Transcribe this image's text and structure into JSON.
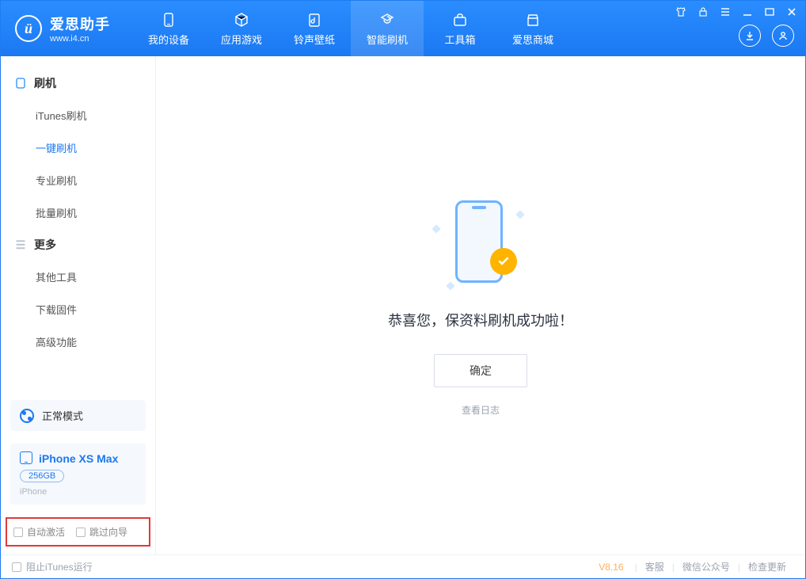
{
  "app": {
    "name_cn": "爱思助手",
    "name_en": "www.i4.cn",
    "logo_letter": "ü"
  },
  "nav": {
    "tabs": [
      {
        "label": "我的设备",
        "icon": "device"
      },
      {
        "label": "应用游戏",
        "icon": "cube"
      },
      {
        "label": "铃声壁纸",
        "icon": "note"
      },
      {
        "label": "智能刷机",
        "icon": "refresh",
        "active": true
      },
      {
        "label": "工具箱",
        "icon": "toolbox"
      },
      {
        "label": "爱思商城",
        "icon": "store"
      }
    ]
  },
  "sidebar": {
    "group1": {
      "title": "刷机",
      "items": [
        {
          "label": "iTunes刷机"
        },
        {
          "label": "一键刷机",
          "active": true
        },
        {
          "label": "专业刷机"
        },
        {
          "label": "批量刷机"
        }
      ]
    },
    "group2": {
      "title": "更多",
      "items": [
        {
          "label": "其他工具"
        },
        {
          "label": "下载固件"
        },
        {
          "label": "高级功能"
        }
      ]
    },
    "mode_label": "正常模式",
    "device": {
      "name": "iPhone XS Max",
      "capacity": "256GB",
      "type": "iPhone"
    },
    "options": {
      "auto_activate": "自动激活",
      "skip_guide": "跳过向导"
    }
  },
  "main": {
    "success_msg": "恭喜您，保资料刷机成功啦！",
    "ok_label": "确定",
    "log_link": "查看日志"
  },
  "footer": {
    "block_itunes": "阻止iTunes运行",
    "version": "V8.16",
    "links": [
      "客服",
      "微信公众号",
      "检查更新"
    ]
  }
}
